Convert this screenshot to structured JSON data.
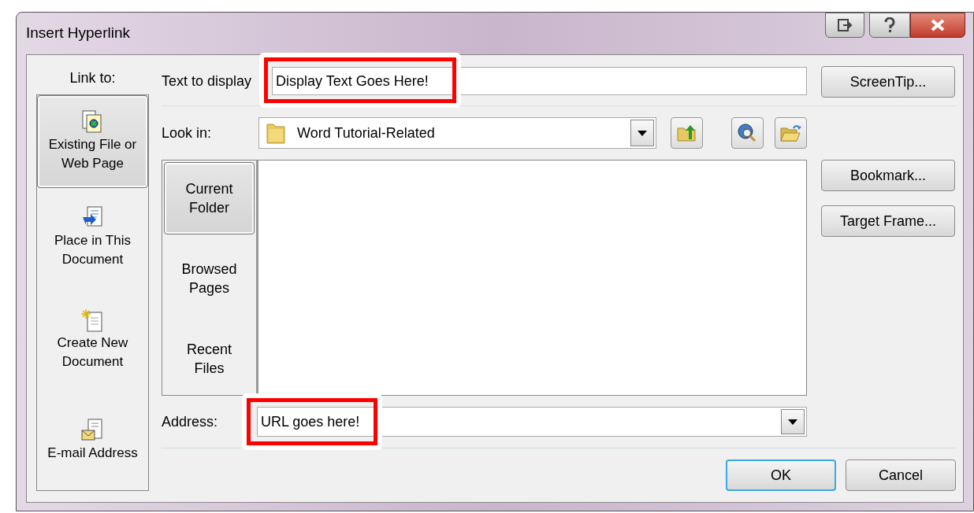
{
  "window": {
    "title": "Insert Hyperlink"
  },
  "link_to": {
    "label": "Link to:",
    "items": [
      {
        "label": "Existing File or Web Page",
        "selected": true
      },
      {
        "label": "Place in This Document",
        "selected": false
      },
      {
        "label": "Create New Document",
        "selected": false
      },
      {
        "label": "E-mail Address",
        "selected": false
      }
    ]
  },
  "text_to_display": {
    "label": "Text to display",
    "value": "Display Text Goes Here!",
    "highlighted": true
  },
  "look_in": {
    "label": "Look in:",
    "value": "Word Tutorial-Related"
  },
  "browse_tabs": [
    {
      "label": "Current Folder",
      "selected": true
    },
    {
      "label": "Browsed Pages",
      "selected": false
    },
    {
      "label": "Recent Files",
      "selected": false
    }
  ],
  "address": {
    "label": "Address:",
    "value": "URL goes here!",
    "highlighted": true
  },
  "side_buttons": [
    "ScreenTip...",
    "Bookmark...",
    "Target Frame..."
  ],
  "buttons": [
    {
      "label": "OK",
      "default": true
    },
    {
      "label": "Cancel",
      "default": false
    }
  ]
}
